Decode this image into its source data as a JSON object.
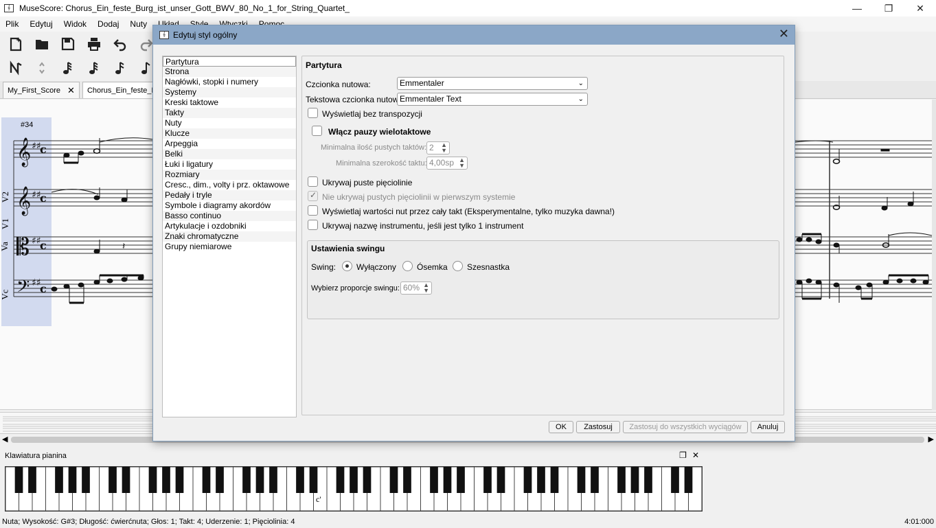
{
  "window": {
    "title": "MuseScore: Chorus_Ein_feste_Burg_ist_unser_Gott_BWV_80_No_1_for_String_Quartet_",
    "app_icon": "musescore-icon",
    "controls": {
      "minimize": "—",
      "maximize": "❐",
      "close": "✕"
    }
  },
  "menu": [
    "Plik",
    "Edytuj",
    "Widok",
    "Dodaj",
    "Nuty",
    "Układ",
    "Style",
    "Wtyczki",
    "Pomoc"
  ],
  "toolbar": {
    "row1": [
      "new-score-icon",
      "open-file-icon",
      "save-icon",
      "print-icon",
      "undo-icon",
      "redo-icon"
    ],
    "row2": [
      "note-input-icon",
      "voice-toggle-icon",
      "sixty-fourth-note-icon",
      "thirty-second-note-icon",
      "sixteenth-note-icon",
      "eighth-note-icon"
    ]
  },
  "tabs": [
    {
      "label": "My_First_Score",
      "close": "✕"
    },
    {
      "label": "Chorus_Ein_feste_B"
    }
  ],
  "score": {
    "measure_number": "#34",
    "staff_labels": [
      "V2",
      "V1",
      "Va",
      "Vc"
    ]
  },
  "dialog": {
    "title": "Edytuj styl ogólny",
    "close": "✕",
    "categories": [
      "Partytura",
      "Strona",
      "Nagłówki, stopki i numery",
      "Systemy",
      "Kreski taktowe",
      "Takty",
      "Nuty",
      "Klucze",
      "Arpeggia",
      "Belki",
      "Łuki i ligatury",
      "Rozmiary",
      "Cresc., dim., volty i prz. oktawowe",
      "Pedały i tryle",
      "Symbole i diagramy akordów",
      "Basso continuo",
      "Artykulacje i ozdobniki",
      "Znaki chromatyczne",
      "Grupy niemiarowe"
    ],
    "selected_category": "Partytura",
    "page": {
      "title": "Partytura",
      "music_font_label": "Czcionka nutowa:",
      "music_font_value": "Emmentaler",
      "text_font_label": "Tekstowa czcionka nutowa:",
      "text_font_value": "Emmentaler Text",
      "concert_pitch": "Wyświetlaj bez transpozycji",
      "multimeasure_rests": "Włącz pauzy wielotaktowe",
      "min_empty_label": "Minimalna ilość pustych taktów:",
      "min_empty_value": "2",
      "min_width_label": "Minimalna szerokość taktu:",
      "min_width_value": "4,00sp",
      "hide_empty_staves": "Ukrywaj puste pięciolinie",
      "dont_hide_first": "Nie ukrywaj pustych pięciolinii w pierwszym systemie",
      "show_measure_duration": "Wyświetlaj wartości nut przez cały takt (Eksperymentalne, tylko muzyka dawna!)",
      "hide_instrument_name": "Ukrywaj nazwę instrumentu, jeśli jest tylko 1 instrument"
    },
    "swing": {
      "title": "Ustawienia swingu",
      "label": "Swing:",
      "options": [
        "Wyłączony",
        "Ósemka",
        "Szesnastka"
      ],
      "selected": "Wyłączony",
      "ratio_label": "Wybierz proporcje swingu:",
      "ratio_value": "60%"
    },
    "buttons": {
      "ok": "OK",
      "apply": "Zastosuj",
      "apply_all": "Zastosuj do wszystkich wyciągów",
      "cancel": "Anuluj"
    }
  },
  "piano": {
    "title": "Klawiatura pianina",
    "undock": "❐",
    "close": "✕",
    "middle_c": "c'"
  },
  "status": {
    "left": "Nuta; Wysokość: G#3; Długość: ćwierćnuta; Głos: 1;  Takt: 4; Uderzenie: 1; Pięciolinia: 4",
    "right": "4:01:000"
  }
}
